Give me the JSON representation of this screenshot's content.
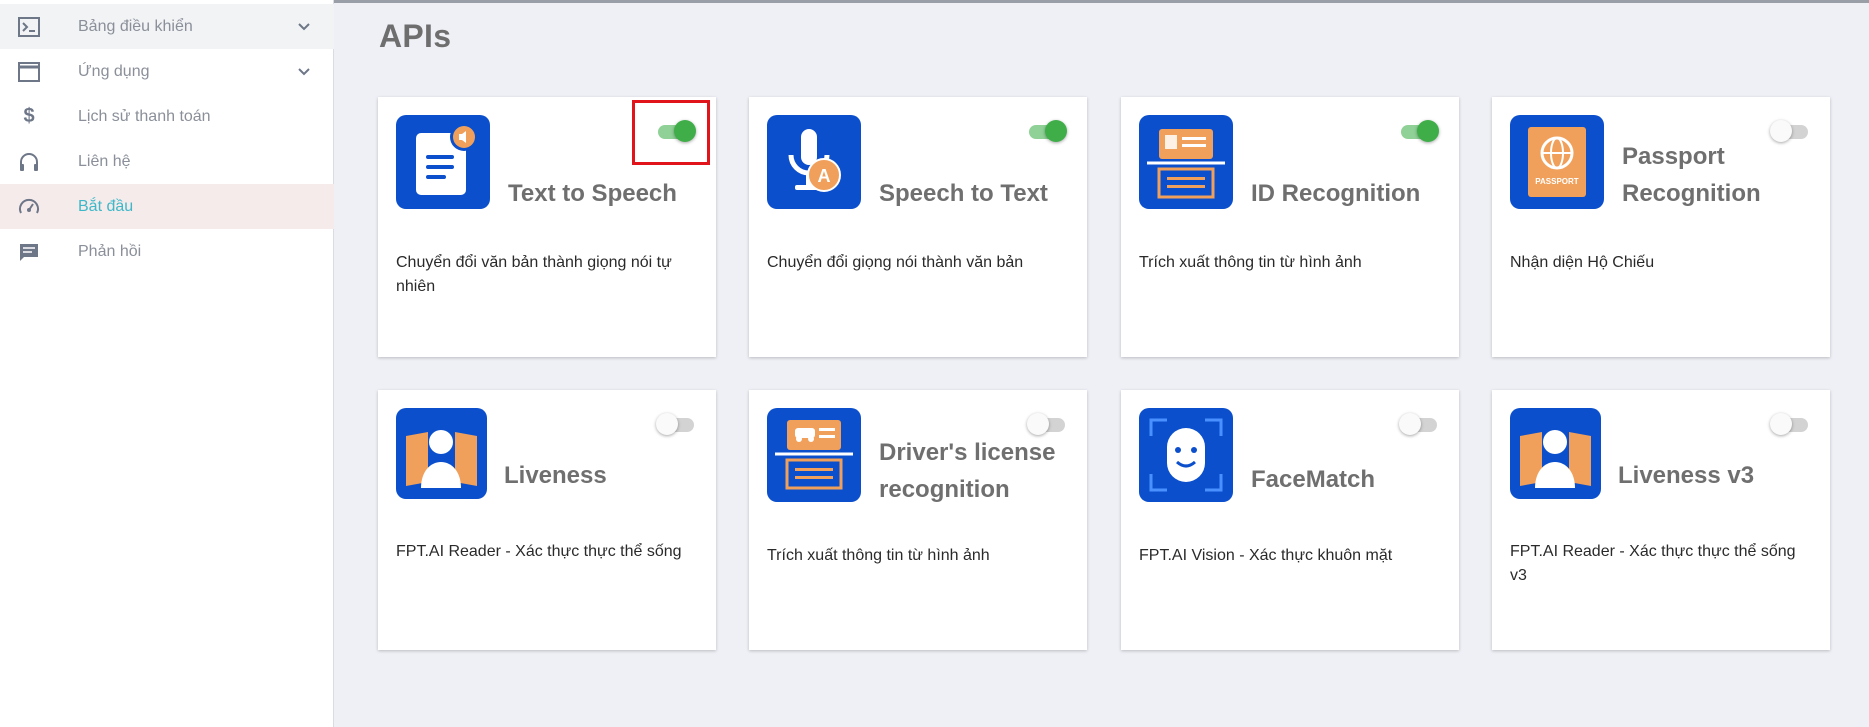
{
  "sidebar": {
    "items": [
      {
        "label": "Bảng điều khiển",
        "icon": "terminal-icon",
        "expandable": true
      },
      {
        "label": "Ứng dụng",
        "icon": "window-icon",
        "expandable": true
      },
      {
        "label": "Lịch sử thanh toán",
        "icon": "dollar-icon"
      },
      {
        "label": "Liên hệ",
        "icon": "headphones-icon"
      },
      {
        "label": "Bắt đầu",
        "icon": "speedometer-icon",
        "active": true
      },
      {
        "label": "Phản hồi",
        "icon": "feedback-icon"
      }
    ]
  },
  "main": {
    "title": "APIs",
    "cards": [
      {
        "title": "Text to Speech",
        "desc": "Chuyển đổi văn bản thành giọng nói tự nhiên",
        "enabled": true
      },
      {
        "title": "Speech to Text",
        "desc": "Chuyển đổi giọng nói thành văn bản",
        "enabled": true
      },
      {
        "title": "ID Recognition",
        "desc": "Trích xuất thông tin từ hình ảnh",
        "enabled": true
      },
      {
        "title": "Passport Recognition",
        "desc": "Nhận diện Hộ Chiếu",
        "enabled": false,
        "icon_text": "PASSPORT"
      },
      {
        "title": "Liveness",
        "desc": "FPT.AI Reader - Xác thực thực thể sống",
        "enabled": false
      },
      {
        "title": "Driver's license recognition",
        "desc": "Trích xuất thông tin từ hình ảnh",
        "enabled": false
      },
      {
        "title": "FaceMatch",
        "desc": "FPT.AI Vision - Xác thực khuôn mặt",
        "enabled": false
      },
      {
        "title": "Liveness v3",
        "desc": "FPT.AI Reader - Xác thực thực thể sống v3",
        "enabled": false
      }
    ]
  },
  "colors": {
    "accent": "#3db8c8",
    "toggle_on": "#3fae49",
    "icon_bg": "#0b4fcc",
    "icon_orange": "#f0a05a",
    "highlight": "#e1141c"
  }
}
